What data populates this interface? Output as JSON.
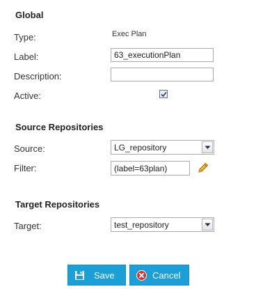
{
  "sections": {
    "global": "Global",
    "source": "Source Repositories",
    "target": "Target Repositories"
  },
  "fields": {
    "type_label": "Type:",
    "type_value": "Exec Plan",
    "label_label": "Label:",
    "label_value": "63_executionPlan",
    "description_label": "Description:",
    "description_value": "",
    "active_label": "Active:",
    "active_checked": true,
    "source_label": "Source:",
    "source_value": "LG_repository",
    "filter_label": "Filter:",
    "filter_value": "(label=63plan)",
    "target_label": "Target:",
    "target_value": "test_repository"
  },
  "buttons": {
    "save": "Save",
    "cancel": "Cancel"
  },
  "icons": {
    "checkbox": "checkmark-icon",
    "dropdown": "chevron-down-icon",
    "filter_edit": "pencil-icon",
    "save": "floppy-disk-icon",
    "cancel": "red-x-circle-icon"
  },
  "colors": {
    "button_bg": "#1a9fd6",
    "cancel_icon": "#e02b2b",
    "pencil": "#f0b429"
  }
}
